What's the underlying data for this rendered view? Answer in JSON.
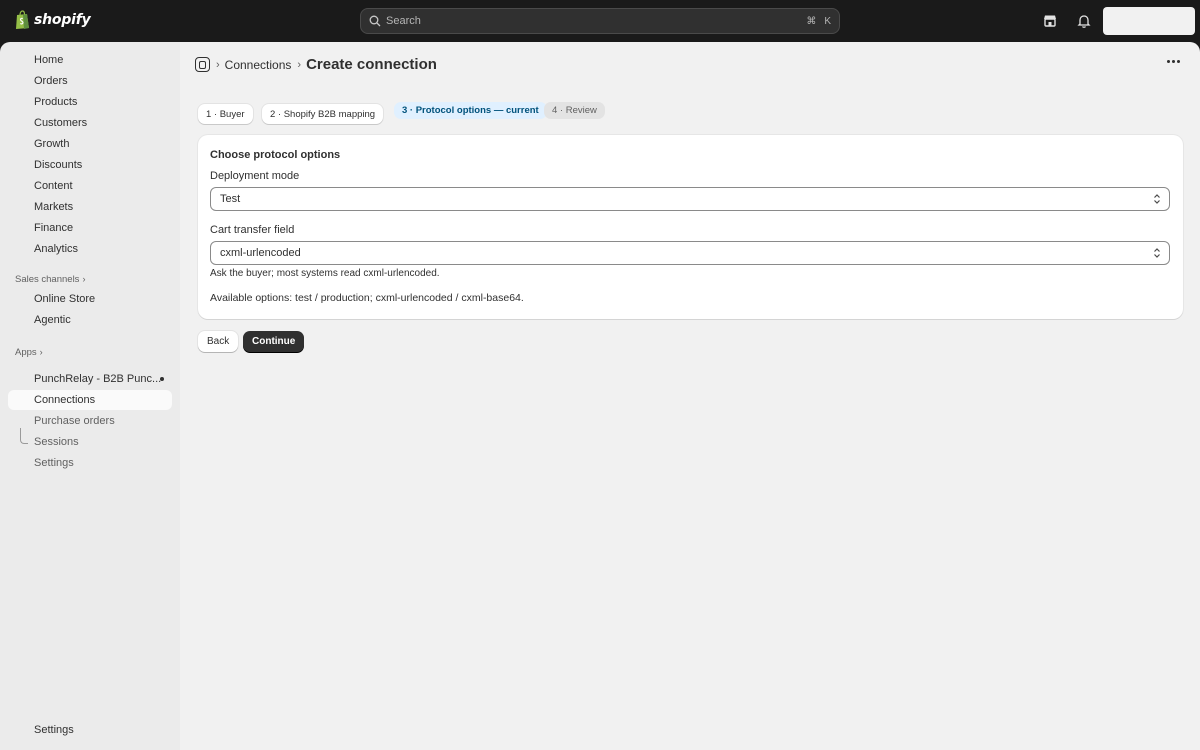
{
  "topbar": {
    "logo_text": "shopify",
    "search_placeholder": "Search",
    "shortcut_cmd": "⌘",
    "shortcut_key": "K"
  },
  "sidebar": {
    "items": [
      {
        "label": "Home"
      },
      {
        "label": "Orders"
      },
      {
        "label": "Products"
      },
      {
        "label": "Customers"
      },
      {
        "label": "Growth"
      },
      {
        "label": "Discounts"
      },
      {
        "label": "Content"
      },
      {
        "label": "Markets"
      },
      {
        "label": "Finance"
      },
      {
        "label": "Analytics"
      }
    ],
    "sales_channels_label": "Sales channels",
    "channels": [
      {
        "label": "Online Store"
      },
      {
        "label": "Agentic"
      }
    ],
    "apps_label": "Apps",
    "app_name": "PunchRelay - B2B Punc...",
    "app_subitems": [
      {
        "label": "Connections"
      },
      {
        "label": "Purchase orders"
      },
      {
        "label": "Sessions"
      },
      {
        "label": "Settings"
      }
    ],
    "settings_label": "Settings"
  },
  "page": {
    "breadcrumb_link": "Connections",
    "title": "Create connection",
    "steps": [
      {
        "label": "1 · Buyer"
      },
      {
        "label": "2 · Shopify B2B mapping"
      },
      {
        "label": "3 · Protocol options — current"
      },
      {
        "label": "4 · Review"
      }
    ],
    "card": {
      "title": "Choose protocol options",
      "deployment_label": "Deployment mode",
      "deployment_value": "Test",
      "cart_label": "Cart transfer field",
      "cart_value": "cxml-urlencoded",
      "cart_help": "Ask the buyer; most systems read cxml-urlencoded.",
      "available_options": "Available options: test / production; cxml-urlencoded / cxml-base64."
    },
    "back_label": "Back",
    "continue_label": "Continue"
  }
}
